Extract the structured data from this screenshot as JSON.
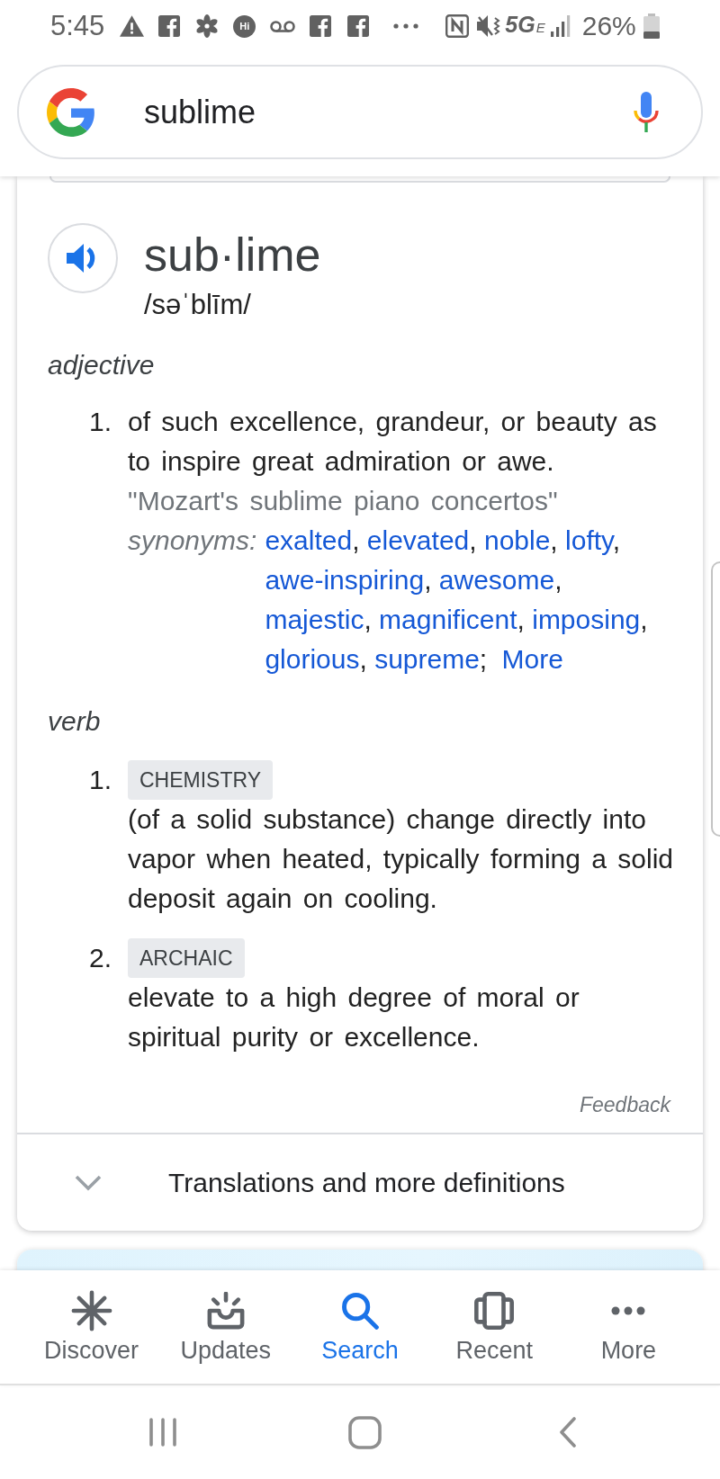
{
  "status_bar": {
    "time": "5:45",
    "app_badge": "Hi",
    "network": "5G",
    "network_sub": "E",
    "battery": "26%"
  },
  "search": {
    "value": "sublime"
  },
  "entry": {
    "word": "sub·lime",
    "phonetic": "/səˈblīm/"
  },
  "senses": [
    {
      "part_of_speech": "adjective",
      "definitions": [
        {
          "number": "1.",
          "text": "of such excellence, grandeur, or beauty as to inspire great admiration or awe.",
          "example": "\"Mozart's sublime piano concertos\"",
          "synonyms_label": "synonyms:",
          "synonyms": [
            {
              "word": "exalted",
              "sep": ","
            },
            {
              "word": "elevated",
              "sep": ","
            },
            {
              "word": "noble",
              "sep": ","
            },
            {
              "word": "lofty",
              "sep": ","
            },
            {
              "word": "awe-inspiring",
              "sep": ","
            },
            {
              "word": "awesome",
              "sep": ","
            },
            {
              "word": "majestic",
              "sep": ","
            },
            {
              "word": "magnificent",
              "sep": ","
            },
            {
              "word": "imposing",
              "sep": ","
            },
            {
              "word": "glorious",
              "sep": ","
            },
            {
              "word": "supreme",
              "sep": ";"
            }
          ],
          "more": "More"
        }
      ]
    },
    {
      "part_of_speech": "verb",
      "definitions": [
        {
          "number": "1.",
          "tag": "CHEMISTRY",
          "text": "(of a solid substance) change directly into vapor when heated, typically forming a solid deposit again on cooling."
        },
        {
          "number": "2.",
          "tag": "ARCHAIC",
          "text": "elevate to a high degree of moral or spiritual purity or excellence."
        }
      ]
    }
  ],
  "feedback": "Feedback",
  "expander": {
    "label": "Translations and more definitions",
    "expanded": false
  },
  "bottom_nav": [
    {
      "label": "Discover",
      "selected": false
    },
    {
      "label": "Updates",
      "selected": false
    },
    {
      "label": "Search",
      "selected": true
    },
    {
      "label": "Recent",
      "selected": false
    },
    {
      "label": "More",
      "selected": false
    }
  ]
}
